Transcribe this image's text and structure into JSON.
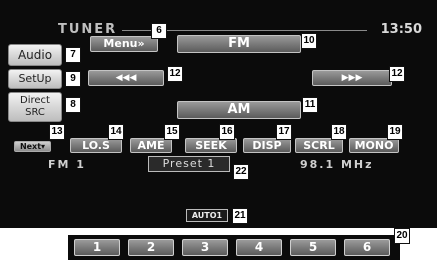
{
  "header": {
    "source": "TUNER",
    "clock": "13:50"
  },
  "sidebar": {
    "audio": "Audio",
    "setup": "SetUp",
    "direct_src": "Direct\nSRC"
  },
  "controls": {
    "menu": "Menu»",
    "fm": "FM",
    "am": "AM",
    "prev": "◀◀◀",
    "next": "▶▶▶",
    "next_page": "Next▾"
  },
  "functions": [
    "LO.S",
    "AME",
    "SEEK",
    "DISP",
    "SCRL",
    "MONO"
  ],
  "status": {
    "band": "FM 1",
    "preset": "Preset 1",
    "frequency": "98.1 MHz",
    "seek_mode": "AUTO1"
  },
  "presets": [
    "1",
    "2",
    "3",
    "4",
    "5",
    "6"
  ],
  "callouts": {
    "c6": "6",
    "c7": "7",
    "c8": "8",
    "c9": "9",
    "c10": "10",
    "c11": "11",
    "c12a": "12",
    "c12b": "12",
    "c13": "13",
    "c14": "14",
    "c15": "15",
    "c16": "16",
    "c17": "17",
    "c18": "18",
    "c19": "19",
    "c20": "20",
    "c21": "21",
    "c22": "22"
  }
}
